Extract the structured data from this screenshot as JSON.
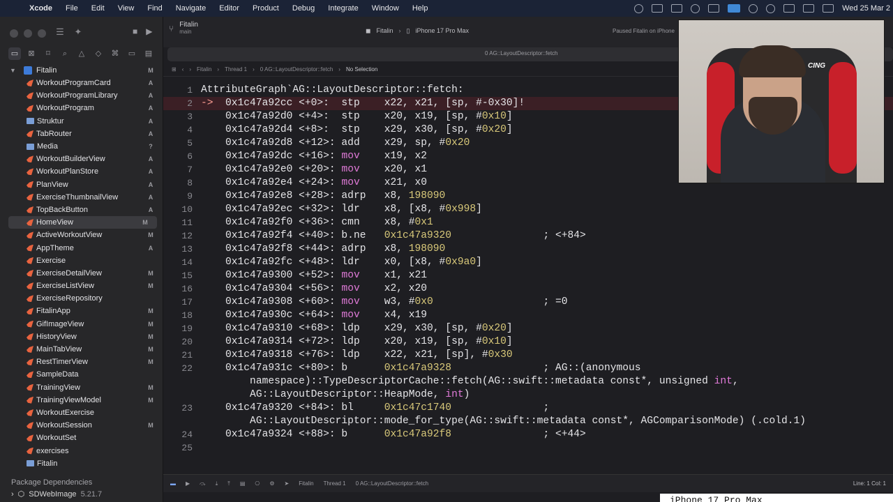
{
  "menubar": {
    "app": "Xcode",
    "items": [
      "File",
      "Edit",
      "View",
      "Find",
      "Navigate",
      "Editor",
      "Product",
      "Debug",
      "Integrate",
      "Window",
      "Help"
    ],
    "clock": "Wed 25 Mar 2"
  },
  "toolbar": {
    "project": "Fitalin",
    "branch": "main",
    "scheme": "Fitalin",
    "destination": "iPhone 17 Pro Max",
    "status": "Paused Fitalin on iPhone"
  },
  "searchbar": {
    "text": "0 AG::LayoutDescriptor::fetch"
  },
  "jumpbar": {
    "project": "Fitalin",
    "thread": "Thread 1",
    "frame": "0 AG::LayoutDescriptor::fetch",
    "selection": "No Selection"
  },
  "sidebar": {
    "root": {
      "name": "Fitalin",
      "badge": "M"
    },
    "files": [
      {
        "name": "WorkoutProgramCard",
        "badge": "A"
      },
      {
        "name": "WorkoutProgramLibrary",
        "badge": "A"
      },
      {
        "name": "WorkoutProgram",
        "badge": "A"
      },
      {
        "name": "Struktur",
        "badge": "A"
      },
      {
        "name": "TabRouter",
        "badge": "A"
      },
      {
        "name": "Media",
        "badge": "?"
      },
      {
        "name": "WorkoutBuilderView",
        "badge": "A"
      },
      {
        "name": "WorkoutPlanStore",
        "badge": "A"
      },
      {
        "name": "PlanView",
        "badge": "A"
      },
      {
        "name": "ExerciseThumbnailView",
        "badge": "A"
      },
      {
        "name": "TopBackButton",
        "badge": "A"
      },
      {
        "name": "HomeView",
        "badge": "M"
      },
      {
        "name": "ActiveWorkoutView",
        "badge": "M"
      },
      {
        "name": "AppTheme",
        "badge": "A"
      },
      {
        "name": "Exercise",
        "badge": ""
      },
      {
        "name": "ExerciseDetailView",
        "badge": "M"
      },
      {
        "name": "ExerciseListView",
        "badge": "M"
      },
      {
        "name": "ExerciseRepository",
        "badge": ""
      },
      {
        "name": "FitalinApp",
        "badge": "M"
      },
      {
        "name": "GifImageView",
        "badge": "M"
      },
      {
        "name": "HistoryView",
        "badge": "M"
      },
      {
        "name": "MainTabView",
        "badge": "M"
      },
      {
        "name": "RestTimerView",
        "badge": "M"
      },
      {
        "name": "SampleData",
        "badge": ""
      },
      {
        "name": "TrainingView",
        "badge": "M"
      },
      {
        "name": "TrainingViewModel",
        "badge": "M"
      },
      {
        "name": "WorkoutExercise",
        "badge": ""
      },
      {
        "name": "WorkoutSession",
        "badge": "M"
      },
      {
        "name": "WorkoutSet",
        "badge": ""
      },
      {
        "name": "exercises",
        "badge": ""
      },
      {
        "name": "Fitalin",
        "badge": ""
      }
    ],
    "package_header": "Package Dependencies",
    "package": {
      "name": "SDWebImage",
      "version": "5.21.7"
    }
  },
  "editor": {
    "lines": [
      {
        "n": "1",
        "html": "AttributeGraph`AG::LayoutDescriptor::fetch:"
      },
      {
        "n": "2",
        "html": "<span class='arrow'>-></span>  0x1c47a92cc <+0>:  stp    x22, x21, [sp, #-0x30]!",
        "pc": true
      },
      {
        "n": "3",
        "html": "    0x1c47a92d0 <+4>:  stp    x20, x19, [sp, #<span class='num'>0x10</span>]"
      },
      {
        "n": "4",
        "html": "    0x1c47a92d4 <+8>:  stp    x29, x30, [sp, #<span class='num'>0x20</span>]"
      },
      {
        "n": "5",
        "html": "    0x1c47a92d8 <+12>: add    x29, sp, #<span class='num'>0x20</span>"
      },
      {
        "n": "6",
        "html": "    0x1c47a92dc <+16>: <span class='kw'>mov</span>    x19, x2"
      },
      {
        "n": "7",
        "html": "    0x1c47a92e0 <+20>: <span class='kw'>mov</span>    x20, x1"
      },
      {
        "n": "8",
        "html": "    0x1c47a92e4 <+24>: <span class='kw'>mov</span>    x21, x0"
      },
      {
        "n": "9",
        "html": "    0x1c47a92e8 <+28>: adrp   x8, <span class='num'>198090</span>"
      },
      {
        "n": "10",
        "html": "    0x1c47a92ec <+32>: ldr    x8, [x8, #<span class='num'>0x998</span>]"
      },
      {
        "n": "11",
        "html": "    0x1c47a92f0 <+36>: cmn    x8, #<span class='num'>0x1</span>"
      },
      {
        "n": "12",
        "html": "    0x1c47a92f4 <+40>: b.ne   <span class='num'>0x1c47a9320</span>               ; <+84>"
      },
      {
        "n": "13",
        "html": "    0x1c47a92f8 <+44>: adrp   x8, <span class='num'>198090</span>"
      },
      {
        "n": "14",
        "html": "    0x1c47a92fc <+48>: ldr    x0, [x8, #<span class='num'>0x9a0</span>]"
      },
      {
        "n": "15",
        "html": "    0x1c47a9300 <+52>: <span class='kw'>mov</span>    x1, x21"
      },
      {
        "n": "16",
        "html": "    0x1c47a9304 <+56>: <span class='kw'>mov</span>    x2, x20"
      },
      {
        "n": "17",
        "html": "    0x1c47a9308 <+60>: <span class='kw'>mov</span>    w3, #<span class='num'>0x0</span>                  ; =0"
      },
      {
        "n": "18",
        "html": "    0x1c47a930c <+64>: <span class='kw'>mov</span>    x4, x19"
      },
      {
        "n": "19",
        "html": "    0x1c47a9310 <+68>: ldp    x29, x30, [sp, #<span class='num'>0x20</span>]"
      },
      {
        "n": "20",
        "html": "    0x1c47a9314 <+72>: ldp    x20, x19, [sp, #<span class='num'>0x10</span>]"
      },
      {
        "n": "21",
        "html": "    0x1c47a9318 <+76>: ldp    x22, x21, [sp], #<span class='num'>0x30</span>"
      },
      {
        "n": "22",
        "html": "    0x1c47a931c <+80>: b      <span class='num'>0x1c47a9328</span>               ; AG::(anonymous"
      },
      {
        "n": "",
        "html": "        namespace)::TypeDescriptorCache::fetch(AG::swift::metadata const*, unsigned <span class='kw'>int</span>,"
      },
      {
        "n": "",
        "html": "        AG::LayoutDescriptor::HeapMode, <span class='kw'>int</span>)"
      },
      {
        "n": "23",
        "html": "    0x1c47a9320 <+84>: bl     <span class='num'>0x1c47c1740</span>               ;"
      },
      {
        "n": "",
        "html": "        AG::LayoutDescriptor::mode_for_type(AG::swift::metadata const*, AGComparisonMode) (.cold.1)"
      },
      {
        "n": "24",
        "html": "    0x1c47a9324 <+88>: b      <span class='num'>0x1c47a92f8</span>               ; <+44>"
      },
      {
        "n": "25",
        "html": ""
      }
    ]
  },
  "debugbar": {
    "project": "Fitalin",
    "thread": "Thread 1",
    "frame": "0 AG::LayoutDescriptor::fetch",
    "position": "Line: 1  Col: 1"
  },
  "overlay": {
    "chair_brand": "CING",
    "device_tag": "iPhone 17 Pro Max"
  }
}
